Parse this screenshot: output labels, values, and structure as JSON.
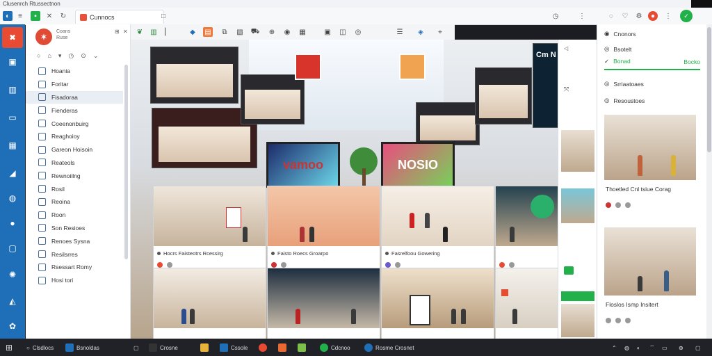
{
  "window": {
    "title": "Clusenrch Rtussectnon"
  },
  "browser": {
    "tab_title": "Cunnocs"
  },
  "sidebar": {
    "brand_sub": "Coans",
    "brand_sub2": "Ruse",
    "items": [
      {
        "label": "Hoania"
      },
      {
        "label": "Foritar"
      },
      {
        "label": "Fisadoraa"
      },
      {
        "label": "Fienderas"
      },
      {
        "label": "Coeenonbuirg"
      },
      {
        "label": "Reaghoioy"
      },
      {
        "label": "Gareon Hoisoin"
      },
      {
        "label": "Reateols"
      },
      {
        "label": "Rewnoiilng"
      },
      {
        "label": "Rosil"
      },
      {
        "label": "Reoina"
      },
      {
        "label": "Roon"
      },
      {
        "label": "Son Resioes"
      },
      {
        "label": "Renoes Sysna"
      },
      {
        "label": "Resilsrres"
      },
      {
        "label": "Rsessart Romy"
      },
      {
        "label": "Hosi tori"
      }
    ]
  },
  "main": {
    "ad_left": "vamoo",
    "ad_right": "NOSIO",
    "store_sign": "Cm N",
    "cards": [
      {
        "caption": "Hocrs Faisteotrs Rcessirg"
      },
      {
        "caption": "Faisto Roecs Groarpo"
      },
      {
        "caption": "Fasrelfoou Gowering"
      },
      {
        "caption": ""
      },
      {
        "caption": ""
      },
      {
        "caption": ""
      },
      {
        "caption": ""
      },
      {
        "caption": ""
      }
    ]
  },
  "right": {
    "header": "Cnonors",
    "user1": "Bsotelt",
    "user1_sub": "Bonad",
    "user1_note": "Bocko",
    "section": "Srriaatoaes",
    "section_sub": "Resoustoes",
    "card1_title": "Thoetled Cnl tsiue Corag",
    "card2_title": "Floslos Ismp Insitert"
  },
  "taskbar": {
    "search": "Clsdlocs",
    "app1": "Bsnoldas",
    "app2": "Crosne",
    "app3": "Cssole",
    "app4": "Cdcnoo",
    "app5": "Rosme Crosnet"
  },
  "colors": {
    "accent": "#e84a32",
    "rail": "#1f6fb8",
    "online": "#22b04a"
  }
}
